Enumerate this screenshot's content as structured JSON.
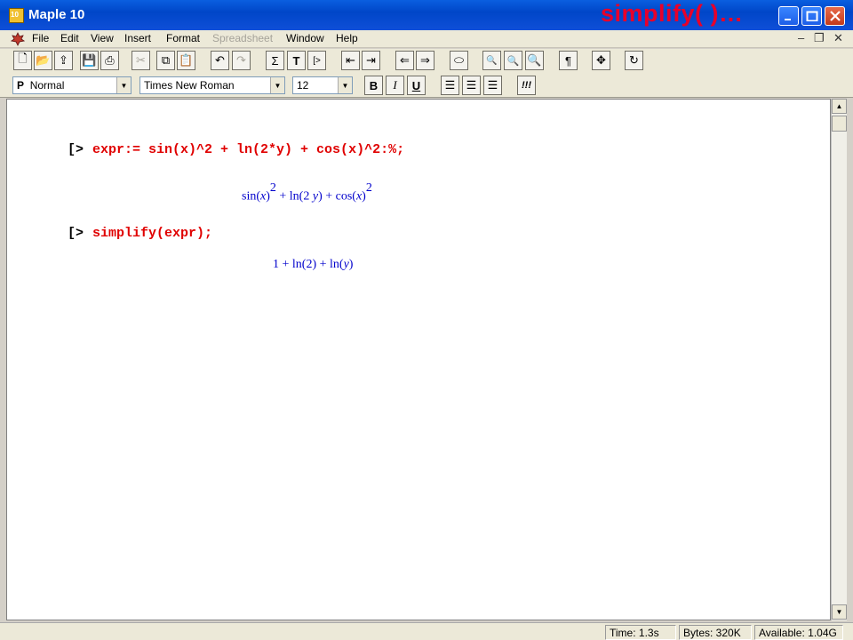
{
  "window": {
    "title": "Maple 10",
    "overlay_title": "simplify( )…",
    "accent": "#0046c8"
  },
  "menu": {
    "items": [
      "File",
      "Edit",
      "View",
      "Insert",
      "Format",
      "Spreadsheet",
      "Window",
      "Help"
    ],
    "disabled": [
      "Spreadsheet"
    ]
  },
  "toolbar": {
    "style_select": "Normal",
    "style_prefix": "P",
    "font_select": "Times New Roman",
    "size_select": "12",
    "bold_label": "B",
    "italic_label": "I",
    "underline_label": "U",
    "exec_label": "!!!"
  },
  "worksheet": {
    "prompt_symbol": "[>",
    "input1": "expr:= sin(x)^2 + ln(2*y) + cos(x)^2:%;",
    "output1": "sin(x)² + ln(2 y) + cos(x)²",
    "input2": "simplify(expr);",
    "output2": "1 + ln(2) + ln(y)"
  },
  "status": {
    "time": "Time:  1.3s",
    "bytes": "Bytes:  320K",
    "available": "Available: 1.04G"
  }
}
